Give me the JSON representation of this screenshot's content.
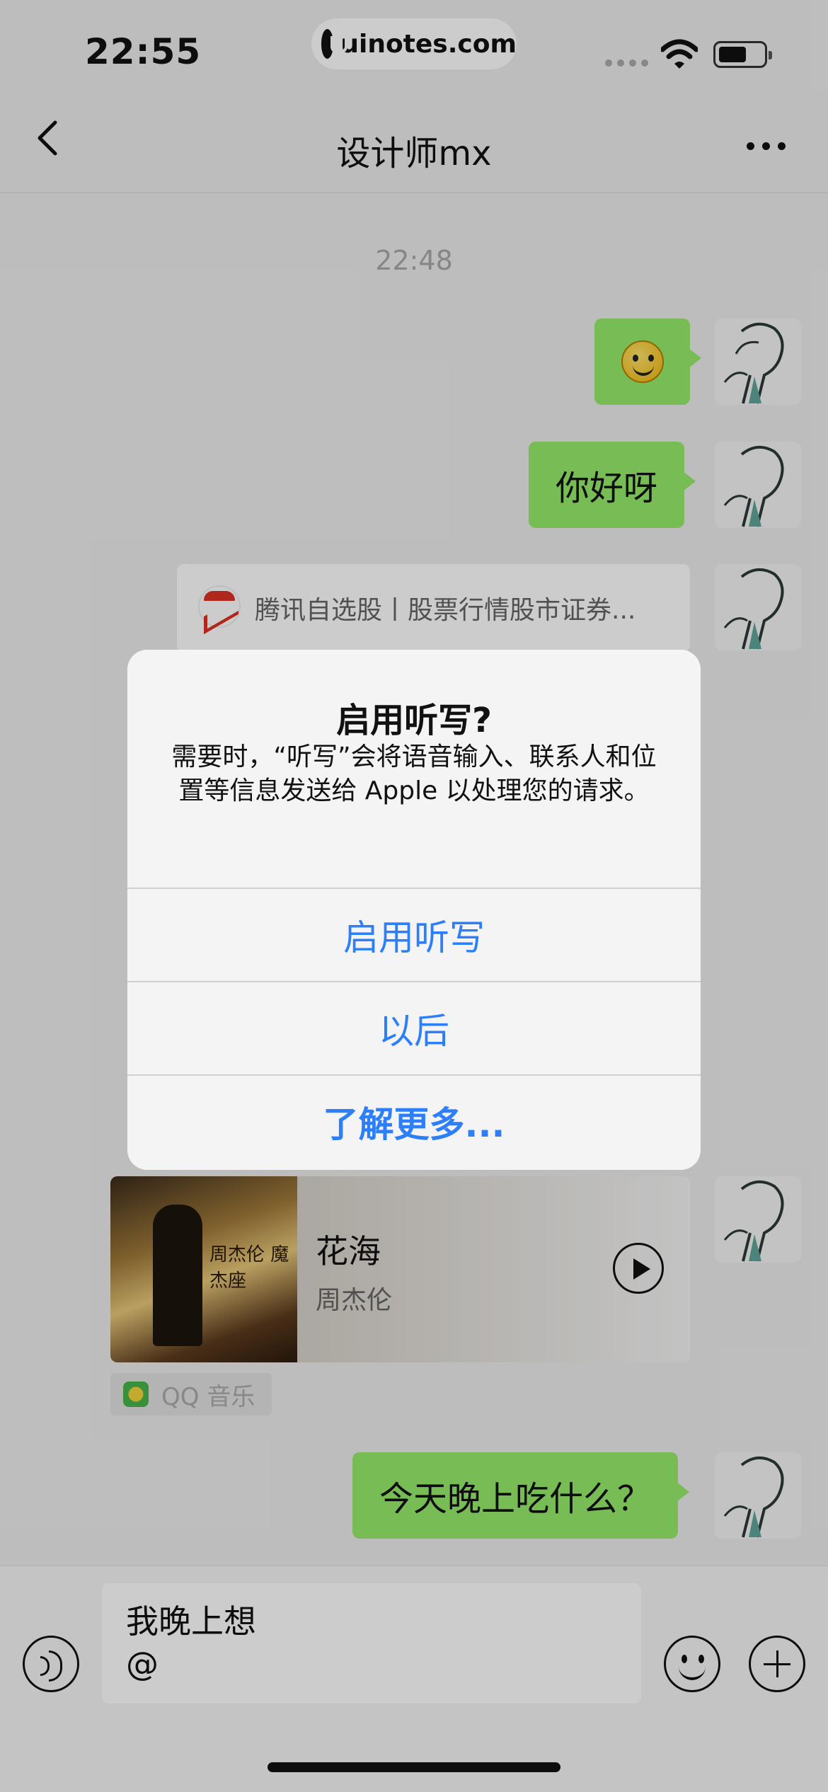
{
  "status_bar": {
    "time": "22:55",
    "watermark": "uinotes.com"
  },
  "nav": {
    "title": "设计师mx"
  },
  "chat": {
    "timestamp": "22:48",
    "messages": [
      {
        "type": "emoji",
        "icon": "smiley-emoji"
      },
      {
        "type": "text",
        "text": "你好呀"
      },
      {
        "type": "link",
        "title": "腾讯自选股丨股票行情股市证券..."
      },
      {
        "type": "music",
        "song": "花海",
        "artist": "周杰伦",
        "album_text": "周杰伦 魔杰座",
        "source": "QQ 音乐"
      },
      {
        "type": "text",
        "text": "今天晚上吃什么？"
      }
    ]
  },
  "input": {
    "line1": "我晚上想",
    "line2": "@"
  },
  "alert": {
    "title": "启用听写?",
    "message": "需要时，“听写”会将语音输入、联系人和位置等信息发送给 Apple 以处理您的请求。",
    "buttons": [
      "启用听写",
      "以后",
      "了解更多..."
    ],
    "button_color": "#2d7ff9"
  }
}
